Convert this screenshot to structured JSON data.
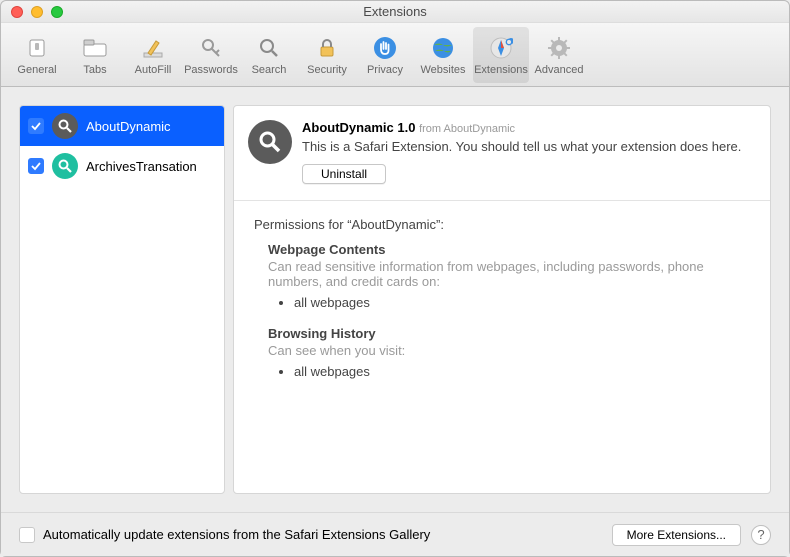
{
  "window": {
    "title": "Extensions"
  },
  "toolbar": {
    "items": [
      {
        "label": "General"
      },
      {
        "label": "Tabs"
      },
      {
        "label": "AutoFill"
      },
      {
        "label": "Passwords"
      },
      {
        "label": "Search"
      },
      {
        "label": "Security"
      },
      {
        "label": "Privacy"
      },
      {
        "label": "Websites"
      },
      {
        "label": "Extensions"
      },
      {
        "label": "Advanced"
      }
    ]
  },
  "sidebar": {
    "items": [
      {
        "name": "AboutDynamic",
        "checked": true,
        "selected": true,
        "color": "dark"
      },
      {
        "name": "ArchivesTransation",
        "checked": true,
        "selected": false,
        "color": "teal"
      }
    ]
  },
  "detail": {
    "name": "AboutDynamic",
    "version": "1.0",
    "from_prefix": "from",
    "from": "AboutDynamic",
    "description": "This is a Safari Extension. You should tell us what your extension does here.",
    "uninstall_label": "Uninstall"
  },
  "permissions": {
    "heading": "Permissions for “AboutDynamic”:",
    "groups": [
      {
        "title": "Webpage Contents",
        "sub": "Can read sensitive information from webpages, including passwords, phone numbers, and credit cards on:",
        "items": [
          "all webpages"
        ]
      },
      {
        "title": "Browsing History",
        "sub": "Can see when you visit:",
        "items": [
          "all webpages"
        ]
      }
    ]
  },
  "footer": {
    "auto_update_label": "Automatically update extensions from the Safari Extensions Gallery",
    "auto_update_checked": true,
    "more_label": "More Extensions...",
    "help": "?"
  }
}
